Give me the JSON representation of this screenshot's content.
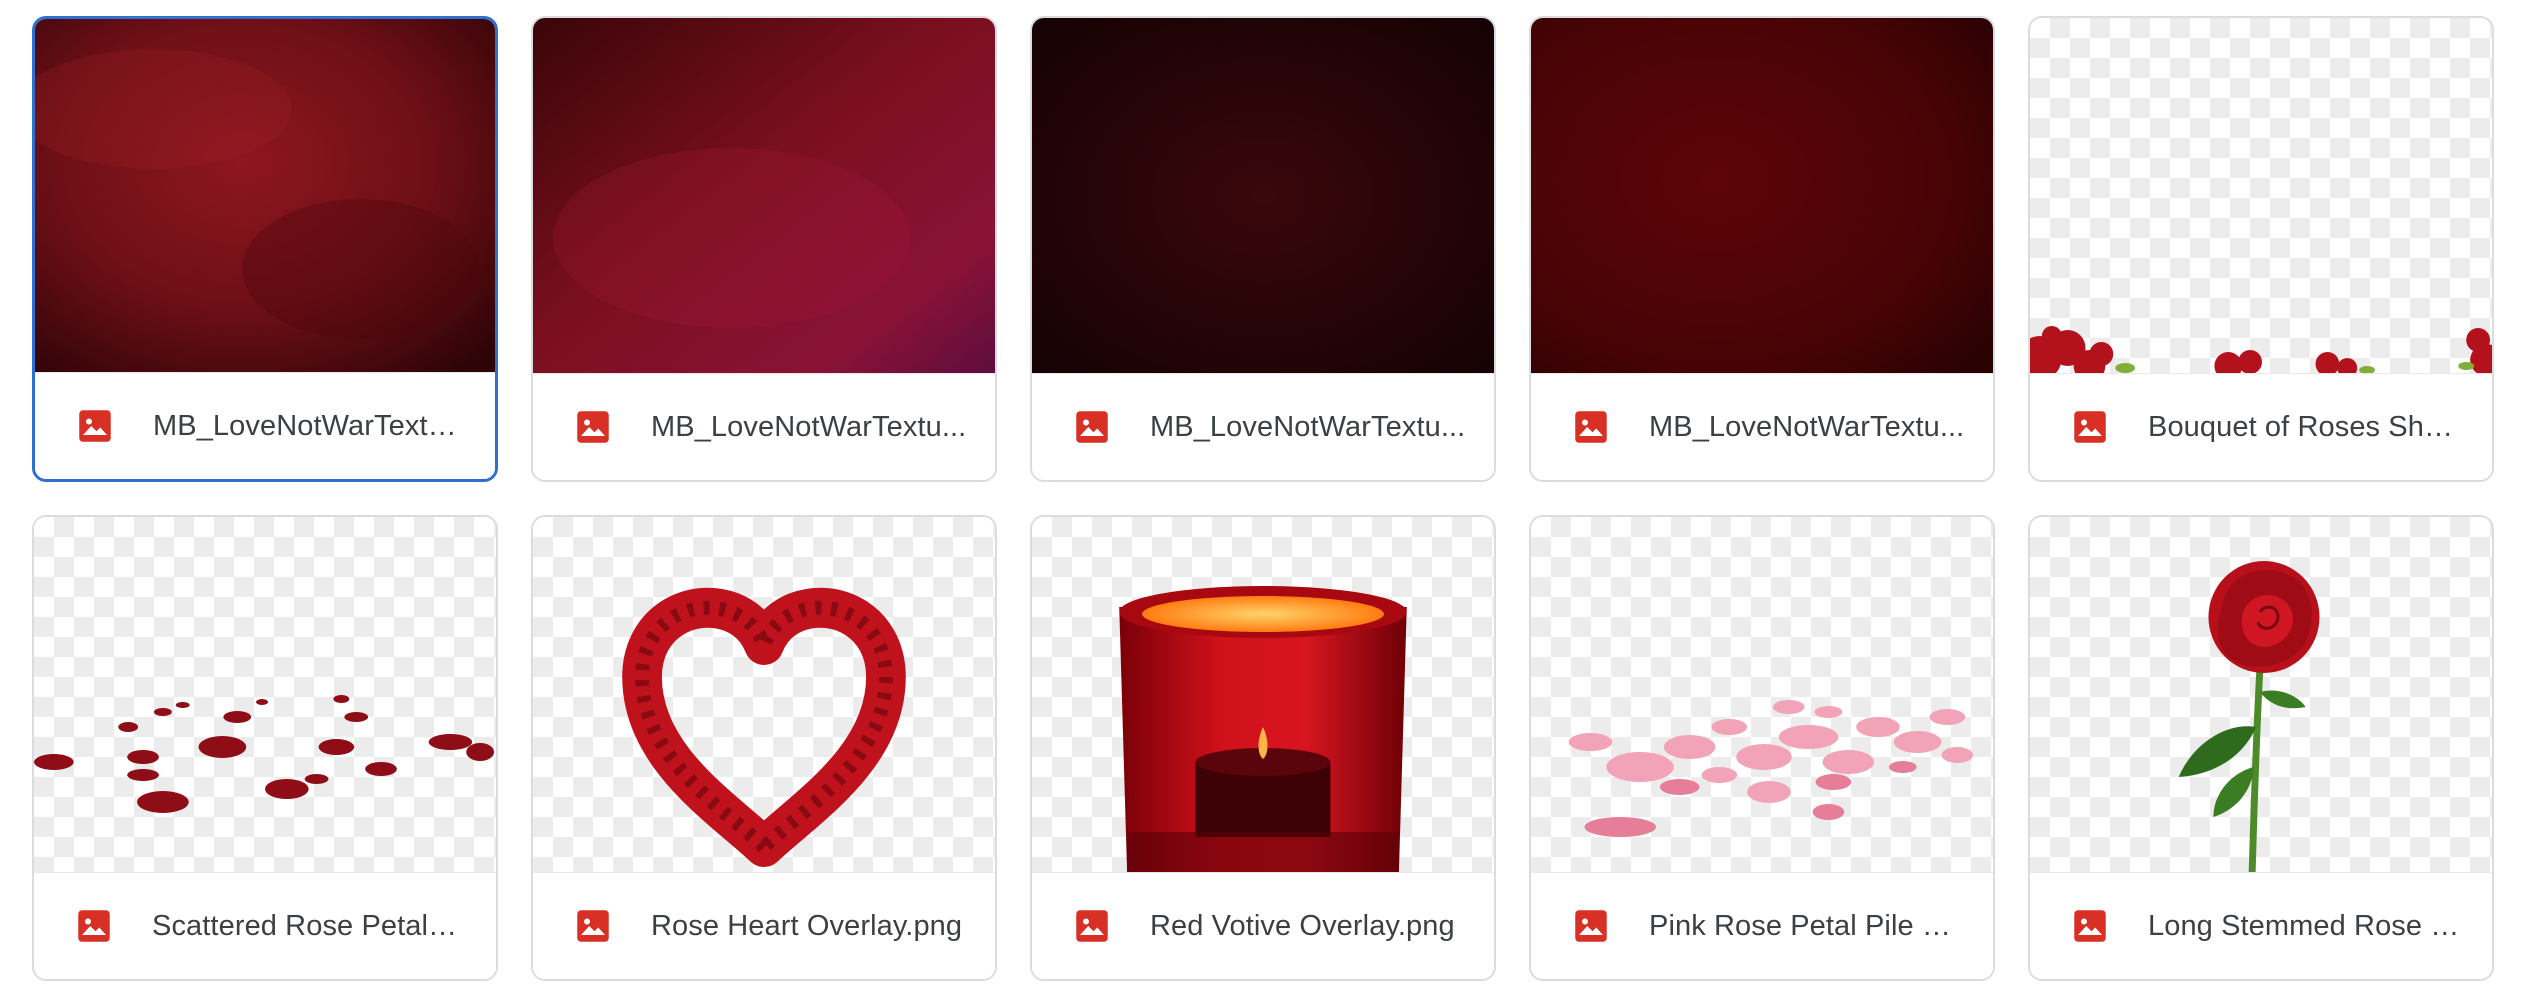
{
  "files": [
    {
      "name": "MB_LoveNotWarTextu...",
      "type_icon": "image-file-icon",
      "thumbnail": "dark red grunge texture",
      "selected": true
    },
    {
      "name": "MB_LoveNotWarTextu...",
      "type_icon": "image-file-icon",
      "thumbnail": "crimson to magenta grunge texture",
      "selected": false
    },
    {
      "name": "MB_LoveNotWarTextu...",
      "type_icon": "image-file-icon",
      "thumbnail": "very dark maroon texture",
      "selected": false
    },
    {
      "name": "MB_LoveNotWarTextu...",
      "type_icon": "image-file-icon",
      "thumbnail": "deep red texture",
      "selected": false
    },
    {
      "name": "Bouquet of Roses Sho...",
      "type_icon": "image-file-icon",
      "thumbnail": "roses along bottom on transparent",
      "selected": false
    },
    {
      "name": "Scattered Rose Petals ...",
      "type_icon": "image-file-icon",
      "thumbnail": "scattered red petals on transparent",
      "selected": false
    },
    {
      "name": "Rose Heart Overlay.png",
      "type_icon": "image-file-icon",
      "thumbnail": "heart of red roses on transparent",
      "selected": false
    },
    {
      "name": "Red Votive Overlay.png",
      "type_icon": "image-file-icon",
      "thumbnail": "red glass votive candle",
      "selected": false
    },
    {
      "name": "Pink Rose Petal Pile O...",
      "type_icon": "image-file-icon",
      "thumbnail": "pile of pink petals on transparent",
      "selected": false
    },
    {
      "name": "Long Stemmed Rose O...",
      "type_icon": "image-file-icon",
      "thumbnail": "single long stemmed red rose",
      "selected": false
    }
  ],
  "colors": {
    "selection_border": "#2f6fcf",
    "card_border": "#dadce0",
    "image_icon": "#d93025",
    "filename_text": "#3c4043"
  }
}
